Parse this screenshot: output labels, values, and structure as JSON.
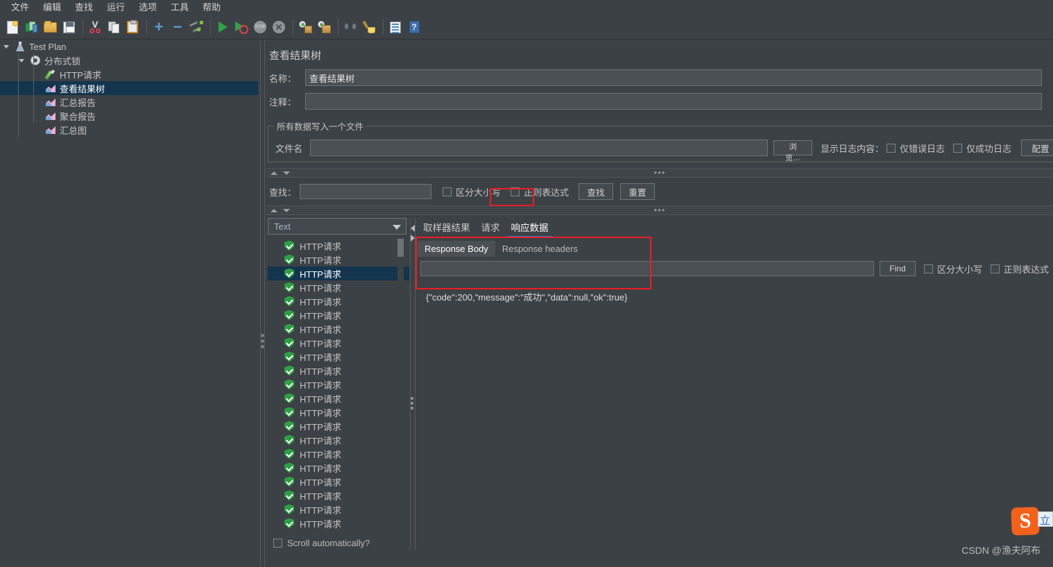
{
  "menu": {
    "items": [
      {
        "label": "文件",
        "name": "menu-file"
      },
      {
        "label": "编辑",
        "name": "menu-edit"
      },
      {
        "label": "查找",
        "name": "menu-search"
      },
      {
        "label": "运行",
        "name": "menu-run"
      },
      {
        "label": "选项",
        "name": "menu-options"
      },
      {
        "label": "工具",
        "name": "menu-tools"
      },
      {
        "label": "帮助",
        "name": "menu-help"
      }
    ]
  },
  "toolbar": {
    "icons": [
      "new-document-icon",
      "templates-icon",
      "open-folder-icon",
      "save-icon",
      "cut-icon",
      "copy-icon",
      "paste-icon",
      "expand-all-icon",
      "collapse-all-icon",
      "toggle-icon",
      "start-icon",
      "start-no-pauses-icon",
      "stop-icon",
      "shutdown-icon",
      "clear-icon",
      "clear-all-icon",
      "search-icon",
      "search-reset-icon",
      "function-helper-icon",
      "help-icon"
    ]
  },
  "tree": {
    "items": [
      {
        "label": "Test Plan",
        "icon": "test-plan-icon",
        "depth": 0,
        "caret": true,
        "selected": false,
        "name": "tree-item-test-plan"
      },
      {
        "label": "分布式锁",
        "icon": "thread-group-icon",
        "depth": 1,
        "caret": true,
        "selected": false,
        "name": "tree-item-thread-group"
      },
      {
        "label": "HTTP请求",
        "icon": "http-sampler-icon",
        "depth": 2,
        "caret": false,
        "selected": false,
        "name": "tree-item-http-request"
      },
      {
        "label": "查看结果树",
        "icon": "listener-icon",
        "depth": 2,
        "caret": false,
        "selected": true,
        "name": "tree-item-view-results-tree"
      },
      {
        "label": "汇总报告",
        "icon": "listener-icon",
        "depth": 2,
        "caret": false,
        "selected": false,
        "name": "tree-item-summary-report"
      },
      {
        "label": "聚合报告",
        "icon": "listener-icon",
        "depth": 2,
        "caret": false,
        "selected": false,
        "name": "tree-item-aggregate-report"
      },
      {
        "label": "汇总图",
        "icon": "listener-icon",
        "depth": 2,
        "caret": false,
        "selected": false,
        "name": "tree-item-summary-graph"
      }
    ]
  },
  "panel": {
    "title": "查看结果树",
    "name_label": "名称：",
    "name_value": "查看结果树",
    "comment_label": "注释：",
    "comment_value": "",
    "file_group_legend": "所有数据写入一个文件",
    "filename_label": "文件名",
    "filename_value": "",
    "browse_button": "浏览…",
    "log_display_label": "显示日志内容：",
    "errors_only_label": "仅错误日志",
    "success_only_label": "仅成功日志",
    "configure_button": "配置"
  },
  "search": {
    "label": "查找：",
    "value": "",
    "case_sensitive_label": "区分大小写",
    "regex_label": "正则表达式",
    "find_button": "查找",
    "reset_button": "重置"
  },
  "results": {
    "renderer_selected": "Text",
    "autoscroll_label": "Scroll automatically?",
    "sample_label": "HTTP请求",
    "sample_count": 24,
    "selected_index": 2,
    "tabs": [
      {
        "label": "取样器结果",
        "active": false,
        "boxed": false,
        "name": "tab-sampler-result"
      },
      {
        "label": "请求",
        "active": false,
        "boxed": false,
        "name": "tab-request"
      },
      {
        "label": "响应数据",
        "active": true,
        "boxed": true,
        "name": "tab-response-data"
      }
    ],
    "subtabs": [
      {
        "label": "Response Body",
        "active": true,
        "name": "subtab-response-body"
      },
      {
        "label": "Response headers",
        "active": false,
        "name": "subtab-response-headers"
      }
    ],
    "find_value": "",
    "find_button": "Find",
    "find_case_label": "区分大小写",
    "find_regex_label": "正则表达式",
    "response_body": "{\"code\":200,\"message\":\"成功\",\"data\":null,\"ok\":true}"
  },
  "watermark": {
    "csdn": "CSDN @渔夫阿布",
    "ime_logo": "S",
    "ime_text": "立"
  },
  "colors": {
    "background": "#3c4145",
    "selection": "#13354e",
    "accent": "#2f7fd0",
    "highlight_box": "#ee1c24",
    "success_green": "#2f9e44"
  }
}
